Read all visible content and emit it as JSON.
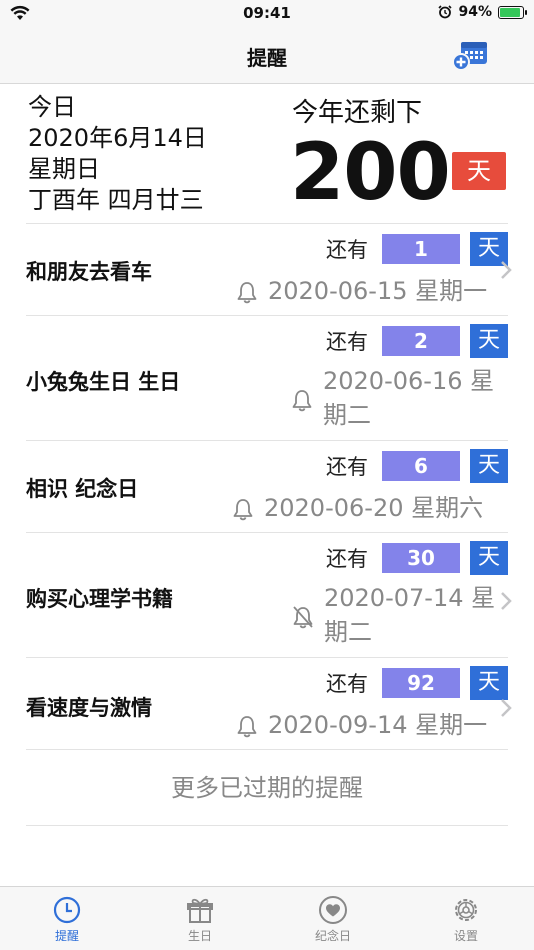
{
  "status": {
    "time": "09:41",
    "battery": "94%",
    "battery_level": 0.94
  },
  "nav": {
    "title": "提醒"
  },
  "summary": {
    "today_label": "今日",
    "date": "2020年6月14日",
    "weekday": "星期日",
    "lunar": "丁酉年 四月廿三",
    "remain_label": "今年还剩下",
    "remain_days": "200",
    "unit": "天"
  },
  "reminders": [
    {
      "title": "和朋友去看车",
      "left_label": "还有",
      "days": "1",
      "unit": "天",
      "date": "2020-06-15 星期一"
    },
    {
      "title": "小兔兔生日 生日",
      "left_label": "还有",
      "days": "2",
      "unit": "天",
      "date": "2020-06-16 星期二"
    },
    {
      "title": "相识 纪念日",
      "left_label": "还有",
      "days": "6",
      "unit": "天",
      "date": "2020-06-20 星期六"
    },
    {
      "title": "购买心理学书籍",
      "left_label": "还有",
      "days": "30",
      "unit": "天",
      "date": "2020-07-14 星期二"
    },
    {
      "title": "看速度与激情",
      "left_label": "还有",
      "days": "92",
      "unit": "天",
      "date": "2020-09-14 星期一"
    }
  ],
  "more_label": "更多已过期的提醒",
  "tabs": [
    {
      "label": "提醒",
      "icon": "clock-icon"
    },
    {
      "label": "生日",
      "icon": "gift-icon"
    },
    {
      "label": "纪念日",
      "icon": "heart-icon"
    },
    {
      "label": "设置",
      "icon": "gear-icon"
    }
  ],
  "colors": {
    "accent": "#2f6fd8",
    "count_bg": "#8383ea",
    "remain_unit_bg": "#e74c3c"
  }
}
